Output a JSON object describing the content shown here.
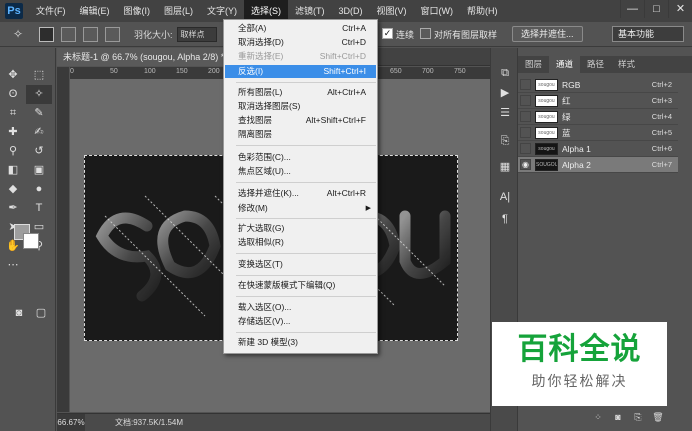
{
  "menubar": {
    "logo": "Ps",
    "items": [
      "文件(F)",
      "编辑(E)",
      "图像(I)",
      "图层(L)",
      "文字(Y)",
      "选择(S)",
      "滤镜(T)",
      "3D(D)",
      "视图(V)",
      "窗口(W)",
      "帮助(H)"
    ],
    "active_index": 5,
    "window_controls": [
      "—",
      "□",
      "✕"
    ]
  },
  "options_bar": {
    "feather_label": "羽化大小:",
    "feather_value": "取样点",
    "antialias_label": "连续",
    "antialias_checked": true,
    "all_layers_label": "对所有图层取样",
    "all_layers_checked": false,
    "select_mask_button": "选择并遮住...",
    "workspace": "基本功能"
  },
  "document": {
    "tab_title": "未标题-1 @ 66.7% (sougou, Alpha 2/8) *",
    "zoom": "66.67%",
    "doc_size": "文档:937.5K/1.54M",
    "canvas_text": "SOUGOU",
    "ruler_ticks": [
      "0",
      "50",
      "100",
      "150",
      "200",
      "250",
      "300",
      "350",
      "400",
      "450",
      "500",
      "550",
      "600",
      "650",
      "700",
      "750",
      "800"
    ]
  },
  "select_menu": {
    "items": [
      {
        "label": "全部(A)",
        "shortcut": "Ctrl+A",
        "disabled": false
      },
      {
        "label": "取消选择(D)",
        "shortcut": "Ctrl+D",
        "disabled": false
      },
      {
        "label": "重新选择(E)",
        "shortcut": "Shift+Ctrl+D",
        "disabled": true
      },
      {
        "label": "反选(I)",
        "shortcut": "Shift+Ctrl+I",
        "disabled": false,
        "highlighted": true
      },
      {
        "label": "所有图层(L)",
        "shortcut": "Alt+Ctrl+A",
        "disabled": false
      },
      {
        "label": "取消选择图层(S)",
        "shortcut": "",
        "disabled": false
      },
      {
        "label": "查找图层",
        "shortcut": "Alt+Shift+Ctrl+F",
        "disabled": false
      },
      {
        "label": "隔离图层",
        "shortcut": "",
        "disabled": false
      },
      {
        "label": "色彩范围(C)...",
        "shortcut": "",
        "disabled": false
      },
      {
        "label": "焦点区域(U)...",
        "shortcut": "",
        "disabled": false
      },
      {
        "label": "选择并遮住(K)...",
        "shortcut": "Alt+Ctrl+R",
        "disabled": false
      },
      {
        "label": "修改(M)",
        "shortcut": "",
        "disabled": false,
        "submenu": true
      },
      {
        "label": "扩大选取(G)",
        "shortcut": "",
        "disabled": false
      },
      {
        "label": "选取相似(R)",
        "shortcut": "",
        "disabled": false
      },
      {
        "label": "变换选区(T)",
        "shortcut": "",
        "disabled": false
      },
      {
        "label": "在快速蒙版模式下编辑(Q)",
        "shortcut": "",
        "disabled": false
      },
      {
        "label": "载入选区(O)...",
        "shortcut": "",
        "disabled": false
      },
      {
        "label": "存储选区(V)...",
        "shortcut": "",
        "disabled": false
      },
      {
        "label": "新建 3D 模型(3)",
        "shortcut": "",
        "disabled": false
      }
    ]
  },
  "channels_panel": {
    "tabs": [
      "图层",
      "通道",
      "路径",
      "样式"
    ],
    "active_tab": 1,
    "channels": [
      {
        "name": "RGB",
        "shortcut": "Ctrl+2",
        "thumb": "sougou",
        "dark": false,
        "visible": false,
        "selected": false
      },
      {
        "name": "红",
        "shortcut": "Ctrl+3",
        "thumb": "sougou",
        "dark": false,
        "visible": false,
        "selected": false
      },
      {
        "name": "绿",
        "shortcut": "Ctrl+4",
        "thumb": "sougou",
        "dark": false,
        "visible": false,
        "selected": false
      },
      {
        "name": "蓝",
        "shortcut": "Ctrl+5",
        "thumb": "sougou",
        "dark": false,
        "visible": false,
        "selected": false
      },
      {
        "name": "Alpha 1",
        "shortcut": "Ctrl+6",
        "thumb": "sougou",
        "dark": true,
        "visible": false,
        "selected": false
      },
      {
        "name": "Alpha 2",
        "shortcut": "Ctrl+7",
        "thumb": "SOUGOU",
        "dark": true,
        "visible": true,
        "selected": true
      }
    ]
  },
  "watermark": {
    "title": "百科全说",
    "subtitle": "助你轻松解决"
  },
  "colors": {
    "menubar": "#424242",
    "panel": "#535353",
    "menu_highlight": "#3b8ee8",
    "watermark_green": "#15a33a"
  }
}
